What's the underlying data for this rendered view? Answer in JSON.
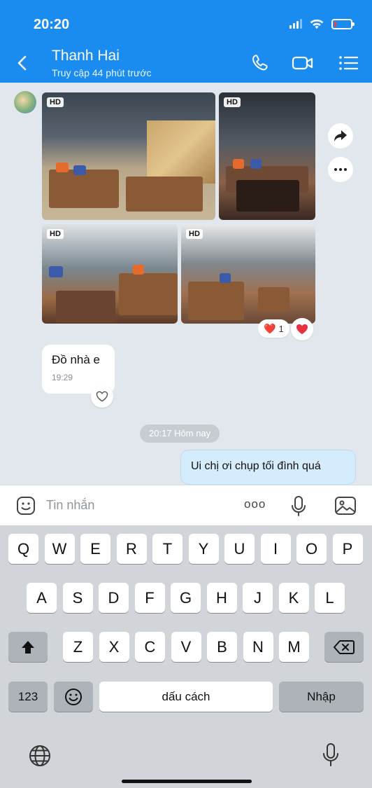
{
  "status": {
    "time": "20:20",
    "battery_level": 0.15,
    "battery_color": "#ff3b30"
  },
  "header": {
    "contact_name": "Thanh Hai",
    "contact_status": "Truy cập 44 phút trước",
    "background": "#1a8cf0",
    "icons": [
      "back-chevron-icon",
      "phone-icon",
      "video-call-icon",
      "menu-list-icon"
    ]
  },
  "messages": {
    "photo_badge": "HD",
    "photo_reaction": {
      "emoji": "❤️",
      "count": "1"
    },
    "incoming_text": "Đồ nhà e",
    "incoming_time": "19:29",
    "date_separator": "20:17 Hôm nay",
    "outgoing_text": "Ui chị ơi chụp tối đình quá"
  },
  "input": {
    "placeholder": "Tin nhắn",
    "more_label": "ooo"
  },
  "keyboard": {
    "row1": [
      "Q",
      "W",
      "E",
      "R",
      "T",
      "Y",
      "U",
      "I",
      "O",
      "P"
    ],
    "row2": [
      "A",
      "S",
      "D",
      "F",
      "G",
      "H",
      "J",
      "K",
      "L"
    ],
    "row3": [
      "Z",
      "X",
      "C",
      "V",
      "B",
      "N",
      "M"
    ],
    "numbers_label": "123",
    "space_label": "dấu cách",
    "return_label": "Nhập"
  }
}
